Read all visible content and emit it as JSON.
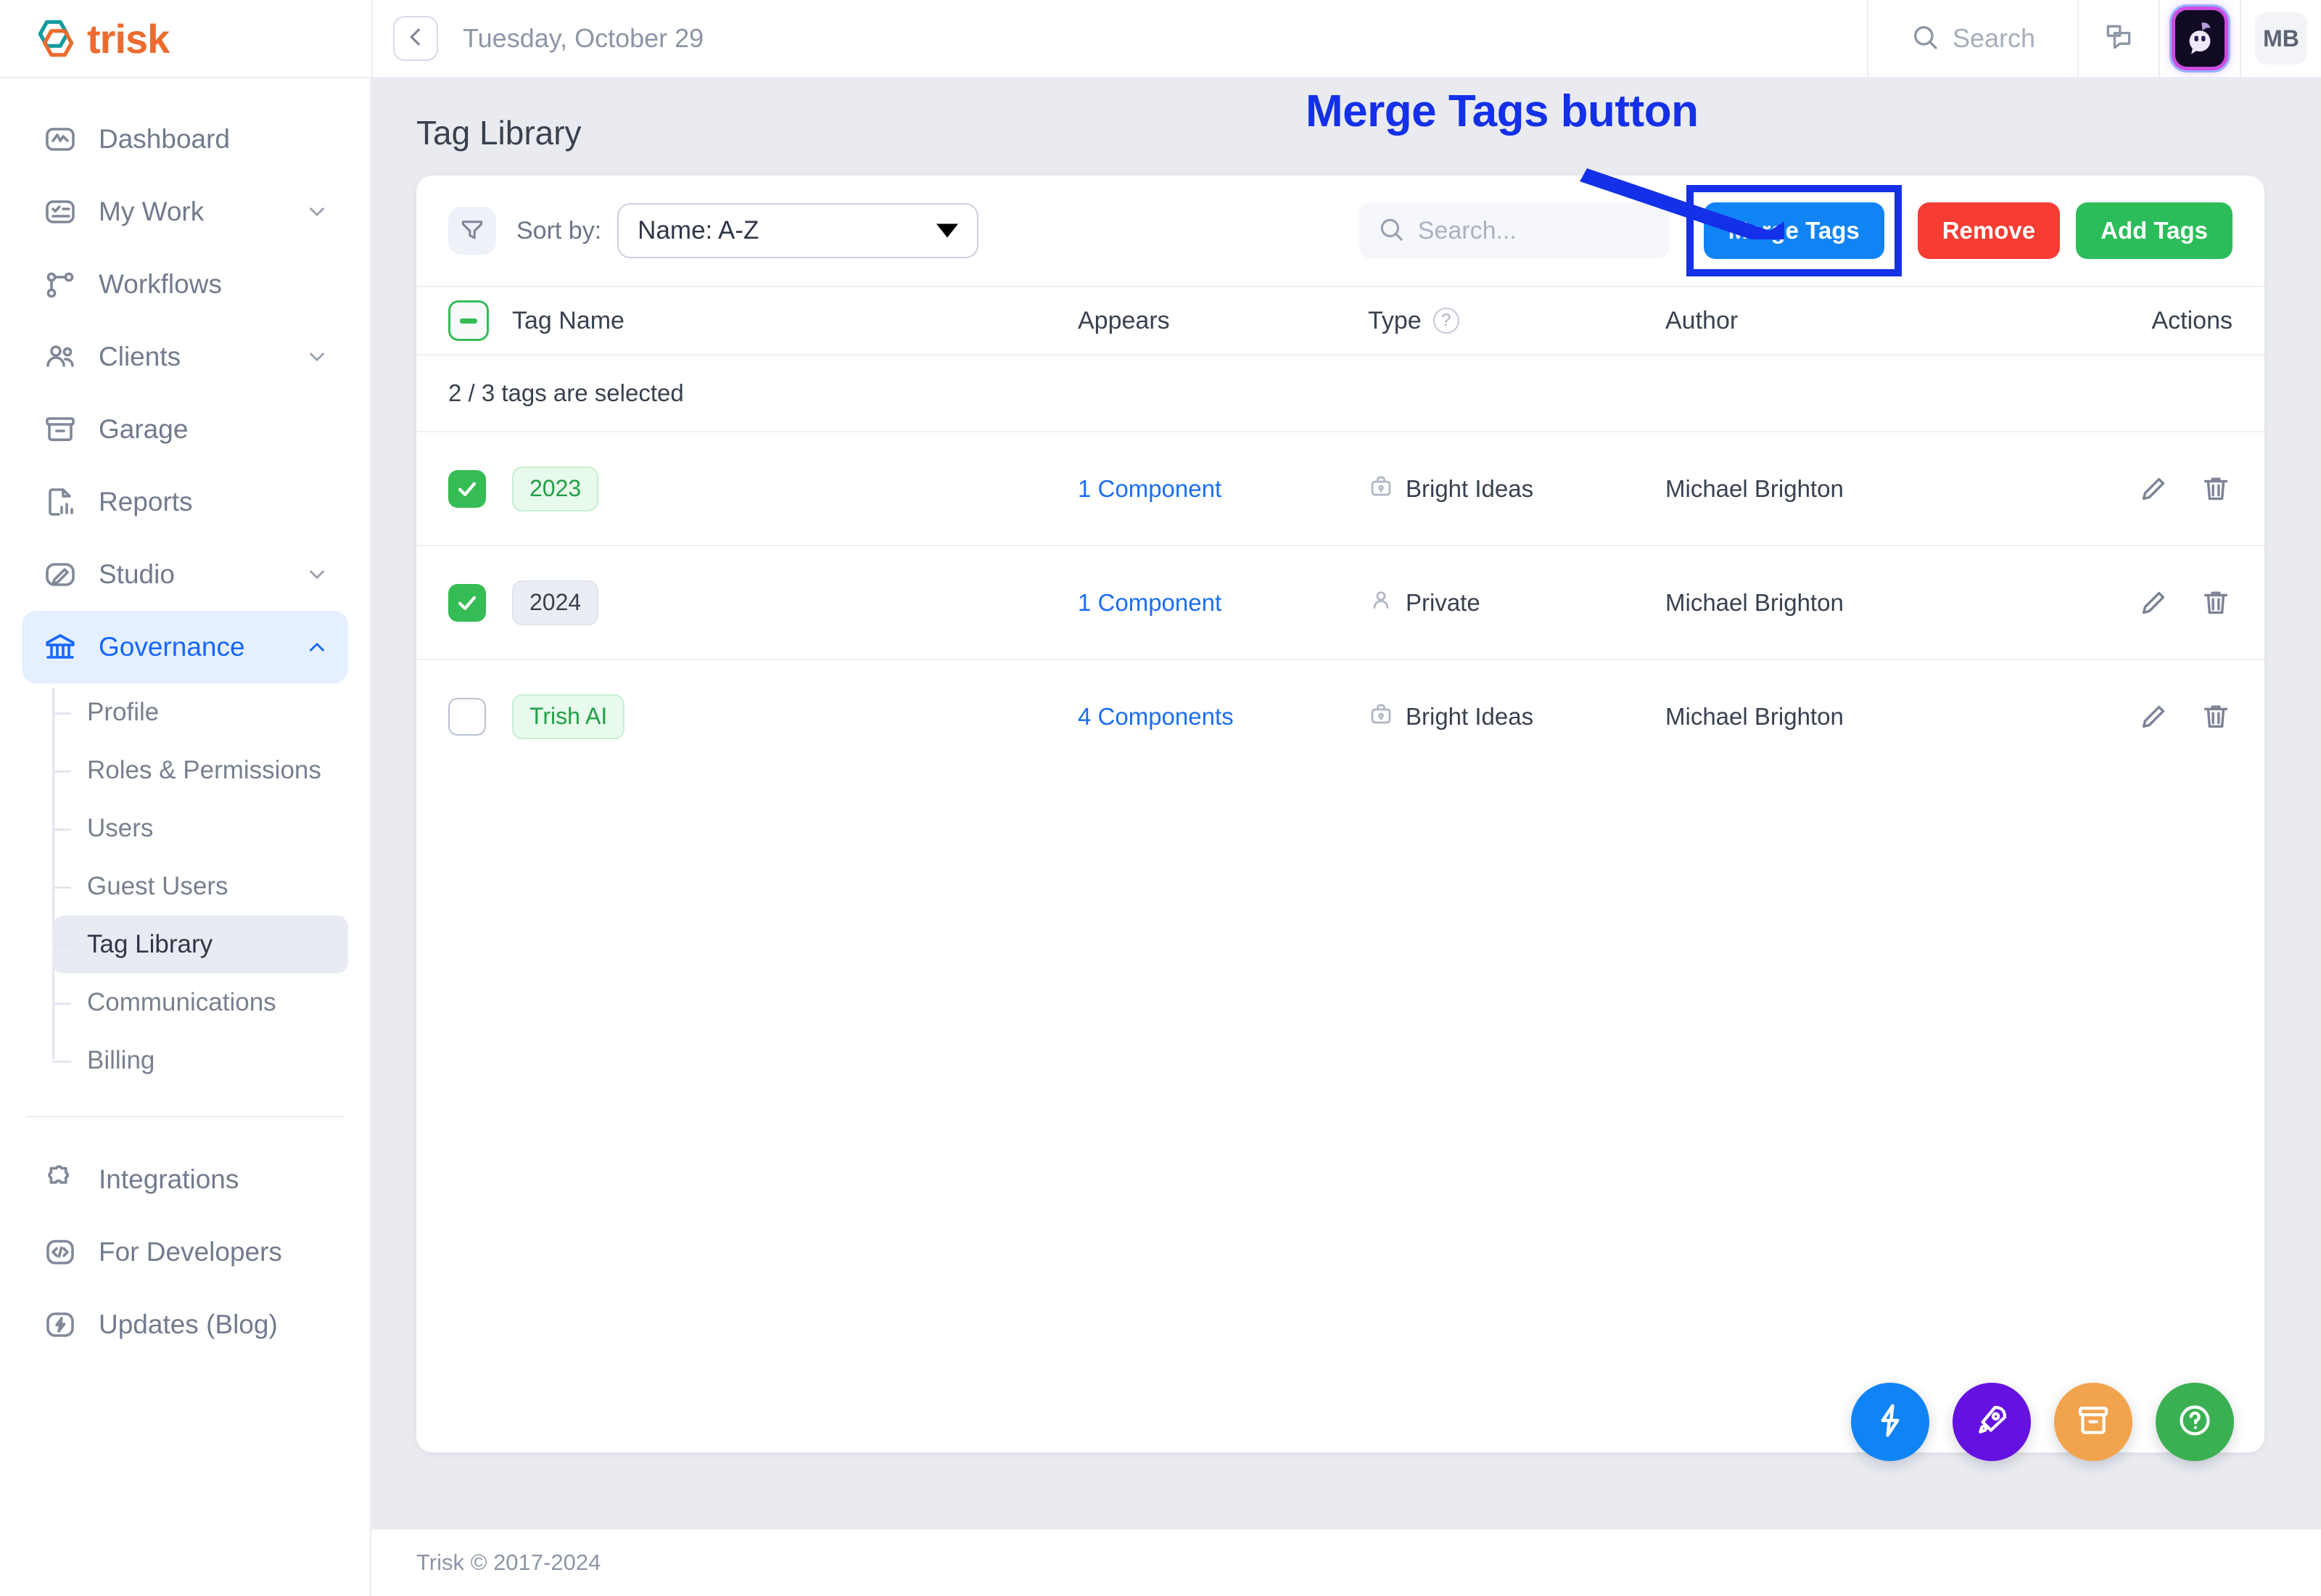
{
  "brand": {
    "name": "trisk",
    "logo_icon": "trisk-hexagon-logo"
  },
  "topbar": {
    "collapse_icon": "chevron-left-icon",
    "date": "Tuesday, October 29",
    "search_label": "Search",
    "search_icon": "search-icon",
    "chat_icon": "chat-bubbles-icon",
    "bot_icon": "ai-assistant-icon",
    "avatar_initials": "MB"
  },
  "sidebar": {
    "items": [
      {
        "label": "Dashboard",
        "icon": "dashboard-icon",
        "expandable": false
      },
      {
        "label": "My Work",
        "icon": "my-work-icon",
        "expandable": true
      },
      {
        "label": "Workflows",
        "icon": "workflows-icon",
        "expandable": false
      },
      {
        "label": "Clients",
        "icon": "clients-icon",
        "expandable": true
      },
      {
        "label": "Garage",
        "icon": "garage-icon",
        "expandable": false
      },
      {
        "label": "Reports",
        "icon": "reports-icon",
        "expandable": false
      },
      {
        "label": "Studio",
        "icon": "studio-icon",
        "expandable": true
      },
      {
        "label": "Governance",
        "icon": "governance-icon",
        "expandable": true,
        "active": true
      }
    ],
    "governance_subitems": [
      {
        "label": "Profile"
      },
      {
        "label": "Roles & Permissions"
      },
      {
        "label": "Users"
      },
      {
        "label": "Guest Users"
      },
      {
        "label": "Tag Library",
        "active": true
      },
      {
        "label": "Communications"
      },
      {
        "label": "Billing"
      }
    ],
    "bottom_items": [
      {
        "label": "Integrations",
        "icon": "puzzle-icon"
      },
      {
        "label": "For Developers",
        "icon": "code-brackets-icon"
      },
      {
        "label": "Updates (Blog)",
        "icon": "lightning-bolt-icon"
      }
    ]
  },
  "page": {
    "title": "Tag Library"
  },
  "toolbar": {
    "filter_icon": "filter-funnel-icon",
    "sort_label": "Sort by:",
    "sort_value": "Name: A-Z",
    "sort_caret_icon": "caret-down-icon",
    "search_icon": "search-icon",
    "search_placeholder": "Search...",
    "search_value": "",
    "merge_label": "Merge Tags",
    "remove_label": "Remove",
    "add_label": "Add Tags"
  },
  "table": {
    "headers": {
      "tag_name": "Tag Name",
      "appears": "Appears",
      "type": "Type",
      "type_help_icon": "question-mark-icon",
      "author": "Author",
      "actions": "Actions"
    },
    "selection_text": "2 / 3 tags are selected",
    "header_checkbox_state": "indeterminate",
    "rows": [
      {
        "checked": true,
        "tag": "2023",
        "tag_style": "green",
        "appears": "1 Component",
        "type": "Bright Ideas",
        "type_icon": "briefcase-icon",
        "author": "Michael Brighton",
        "edit_icon": "pencil-icon",
        "delete_icon": "trash-icon"
      },
      {
        "checked": true,
        "tag": "2024",
        "tag_style": "grey",
        "appears": "1 Component",
        "type": "Private",
        "type_icon": "person-icon",
        "author": "Michael Brighton",
        "edit_icon": "pencil-icon",
        "delete_icon": "trash-icon"
      },
      {
        "checked": false,
        "tag": "Trish AI",
        "tag_style": "green",
        "appears": "4 Components",
        "type": "Bright Ideas",
        "type_icon": "briefcase-icon",
        "author": "Michael Brighton",
        "edit_icon": "pencil-icon",
        "delete_icon": "trash-icon"
      }
    ]
  },
  "fabs": [
    {
      "icon": "lightning-bolt-icon",
      "color": "#1184f5"
    },
    {
      "icon": "rocket-icon",
      "color": "#6511e0"
    },
    {
      "icon": "archive-box-icon",
      "color": "#f2a34e"
    },
    {
      "icon": "help-question-icon",
      "color": "#3bb053"
    }
  ],
  "footer": {
    "text": "Trisk © 2017-2024"
  },
  "annotation": {
    "label": "Merge Tags button",
    "color": "#1430e8",
    "target": "merge-tags-button"
  }
}
